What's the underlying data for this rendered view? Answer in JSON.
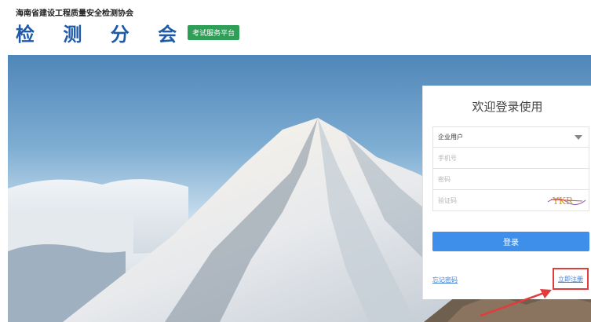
{
  "header": {
    "org_name": "海南省建设工程质量安全检测协会",
    "brand_title": "检 测 分 会",
    "brand_badge": "考试服务平台"
  },
  "login": {
    "title": "欢迎登录使用",
    "user_type_selected": "企业用户",
    "phone_placeholder": "手机号",
    "password_placeholder": "密码",
    "captcha_placeholder": "验证码",
    "captcha_text": "YKR",
    "login_label": "登录",
    "forgot_label": "忘记密码",
    "register_label": "立即注册"
  },
  "colors": {
    "brand_blue": "#1e5aa8",
    "badge_green": "#2f9e57",
    "button_blue": "#3e8fea",
    "link_blue": "#3e7fd8",
    "annotation_red": "#e23b3b"
  }
}
